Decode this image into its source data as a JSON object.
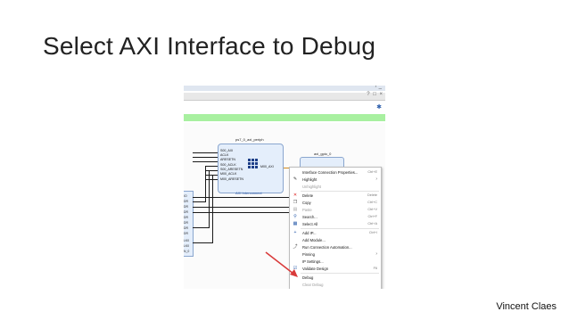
{
  "slide": {
    "title": "Select AXI Interface to Debug",
    "author": "Vincent Claes"
  },
  "screenshot": {
    "topbar_controls": "? _",
    "toolbar_controls": "? □ ×",
    "gear_icon": "gear-icon",
    "interconnect": {
      "title": "ps7_0_axi_periph",
      "label": "AXI Interconnect",
      "ports_in": [
        "S00_AXI",
        "ACLK",
        "ARESETN",
        "S00_ACLK",
        "S00_ARESETN",
        "M00_ACLK",
        "M00_ARESETN"
      ],
      "port_out": "M00_AXI"
    },
    "gpio": {
      "title": "axi_gpio_0"
    },
    "left_ports": [
      "IO",
      "DR",
      "DR",
      "DR",
      "DR",
      "DR",
      "DR",
      "DR",
      "LK0",
      "LK0",
      "N_0"
    ]
  },
  "menu": {
    "items": [
      {
        "icon": "",
        "label": "Interface Connection Properties...",
        "shortcut": "Ctrl+E",
        "disabled": false
      },
      {
        "icon": "highlight-icon",
        "label": "Highlight",
        "shortcut": "",
        "disabled": false,
        "submenu": true
      },
      {
        "icon": "",
        "label": "Unhighlight",
        "shortcut": "",
        "disabled": true
      },
      {
        "icon": "delete-icon",
        "label": "Delete",
        "shortcut": "Delete",
        "disabled": false
      },
      {
        "icon": "copy-icon",
        "label": "Copy",
        "shortcut": "Ctrl+C",
        "disabled": false
      },
      {
        "icon": "paste-icon",
        "label": "Paste",
        "shortcut": "Ctrl+V",
        "disabled": true
      },
      {
        "icon": "search-icon",
        "label": "Search...",
        "shortcut": "Ctrl+F",
        "disabled": false
      },
      {
        "icon": "select-all-icon",
        "label": "Select All",
        "shortcut": "Ctrl+A",
        "disabled": false
      },
      {
        "icon": "add-icon",
        "label": "Add IP...",
        "shortcut": "Ctrl+I",
        "disabled": false
      },
      {
        "icon": "",
        "label": "Add Module...",
        "shortcut": "",
        "disabled": false
      },
      {
        "icon": "automation-icon",
        "label": "Run Connection Automation...",
        "shortcut": "",
        "disabled": false
      },
      {
        "icon": "",
        "label": "Pinning",
        "shortcut": "",
        "disabled": false,
        "submenu": true
      },
      {
        "icon": "",
        "label": "IP Settings...",
        "shortcut": "",
        "disabled": false
      },
      {
        "icon": "update-icon",
        "label": "Validate Design",
        "shortcut": "F6",
        "disabled": false
      },
      {
        "icon": "",
        "label": "Debug",
        "shortcut": "",
        "disabled": false
      },
      {
        "icon": "",
        "label": "Clear Debug",
        "shortcut": "",
        "disabled": true
      }
    ]
  },
  "colors": {
    "accent_green": "#a8f0a0",
    "block_fill": "#e4eefb",
    "arrow": "#d93a3a"
  }
}
